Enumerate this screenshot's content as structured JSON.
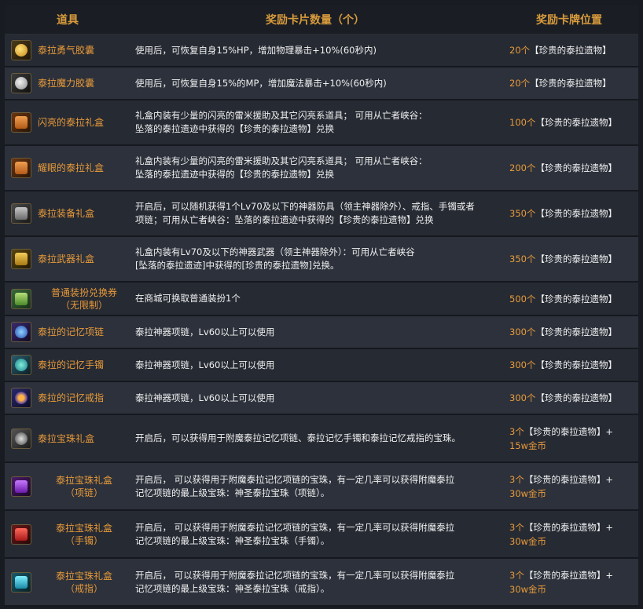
{
  "header": {
    "item": "道具",
    "quantity": "奖励卡片数量（个）",
    "position": "奖励卡牌位置"
  },
  "rows": [
    {
      "icon": "gold-capsule-icon",
      "name_lines": [
        "泰拉勇气胶囊"
      ],
      "desc_lines": [
        "使用后，可恢复自身15%HP，增加物理暴击+10%(60秒内)"
      ],
      "reward_num": "20个",
      "reward_text": "【珍贵的泰拉遗物】",
      "reward_extra": ""
    },
    {
      "icon": "silver-capsule-icon",
      "name_lines": [
        "泰拉魔力胶囊"
      ],
      "desc_lines": [
        "使用后，可恢复自身15%的MP，增加魔法暴击+10%(60秒内)"
      ],
      "reward_num": "20个",
      "reward_text": "【珍贵的泰拉遗物】",
      "reward_extra": ""
    },
    {
      "icon": "orange-giftbox-icon",
      "name_lines": [
        "闪亮的泰拉礼盒"
      ],
      "desc_lines": [
        "礼盒内装有少量的闪亮的雷米援助及其它闪亮系道具； 可用从亡者峡谷：",
        "坠落的泰拉遗迹中获得的【珍贵的泰拉遗物】兑换"
      ],
      "reward_num": "100个",
      "reward_text": "【珍贵的泰拉遗物】",
      "reward_extra": ""
    },
    {
      "icon": "orange-giftbox-icon",
      "name_lines": [
        "耀眼的泰拉礼盒"
      ],
      "desc_lines": [
        "礼盒内装有少量的闪亮的雷米援助及其它闪亮系道具； 可用从亡者峡谷：",
        "坠落的泰拉遗迹中获得的【珍贵的泰拉遗物】兑换"
      ],
      "reward_num": "200个",
      "reward_text": "【珍贵的泰拉遗物】",
      "reward_extra": ""
    },
    {
      "icon": "gray-equipbox-icon",
      "name_lines": [
        "泰拉装备礼盒"
      ],
      "desc_lines": [
        "开启后，可以随机获得1个Lv70及以下的神器防具（领主神器除外）、戒指、手镯或者",
        "项链；可用从亡者峡谷：坠落的泰拉遗迹中获得的【珍贵的泰拉遗物】兑换"
      ],
      "reward_num": "350个",
      "reward_text": "【珍贵的泰拉遗物】",
      "reward_extra": ""
    },
    {
      "icon": "gold-weaponbox-icon",
      "name_lines": [
        "泰拉武器礼盒"
      ],
      "desc_lines": [
        "礼盒内装有Lv70及以下的神器武器（领主神器除外）：可用从亡者峡谷",
        "[坠落的泰拉遗迹]中获得的[珍贵的泰拉遗物]兑换。"
      ],
      "reward_num": "350个",
      "reward_text": "【珍贵的泰拉遗物】",
      "reward_extra": ""
    },
    {
      "icon": "avatar-ticket-icon",
      "name_lines": [
        "普通装扮兑换券",
        "（无限制）"
      ],
      "name_center": true,
      "desc_lines": [
        "在商城可换取普通装扮1个"
      ],
      "reward_num": "500个",
      "reward_text": "【珍贵的泰拉遗物】",
      "reward_extra": ""
    },
    {
      "icon": "necklace-icon",
      "name_lines": [
        "泰拉的记忆项链"
      ],
      "desc_lines": [
        "泰拉神器项链，Lv60以上可以使用"
      ],
      "reward_num": "300个",
      "reward_text": "【珍贵的泰拉遗物】",
      "reward_extra": ""
    },
    {
      "icon": "bracelet-icon",
      "name_lines": [
        "泰拉的记忆手镯"
      ],
      "desc_lines": [
        "泰拉神器项链，Lv60以上可以使用"
      ],
      "reward_num": "300个",
      "reward_text": "【珍贵的泰拉遗物】",
      "reward_extra": ""
    },
    {
      "icon": "ring-icon",
      "name_lines": [
        "泰拉的记忆戒指"
      ],
      "desc_lines": [
        "泰拉神器项链，Lv60以上可以使用"
      ],
      "reward_num": "300个",
      "reward_text": "【珍贵的泰拉遗物】",
      "reward_extra": ""
    },
    {
      "icon": "gem-giftbox-icon",
      "name_lines": [
        "泰拉宝珠礼盒"
      ],
      "desc_lines": [
        "开启后，可以获得用于附魔泰拉记忆项链、泰拉记忆手镯和泰拉记忆戒指的宝珠。"
      ],
      "reward_num": "3个",
      "reward_text": "【珍贵的泰拉遗物】+",
      "reward_extra": "15w金币"
    },
    {
      "icon": "purple-gembox-icon",
      "name_lines": [
        "泰拉宝珠礼盒",
        "（项链）"
      ],
      "name_center": true,
      "desc_lines": [
        "开启后， 可以获得用于附魔泰拉记忆项链的宝珠，有一定几率可以获得附魔泰拉",
        "记忆项链的最上级宝珠：神圣泰拉宝珠（项链）。"
      ],
      "reward_num": "3个",
      "reward_text": "【珍贵的泰拉遗物】+",
      "reward_extra": "30w金币"
    },
    {
      "icon": "red-gembox-icon",
      "name_lines": [
        "泰拉宝珠礼盒",
        "（手镯）"
      ],
      "name_center": true,
      "desc_lines": [
        "开启后， 可以获得用于附魔泰拉记忆项链的宝珠，有一定几率可以获得附魔泰拉",
        "记忆项链的最上级宝珠：神圣泰拉宝珠（手镯）。"
      ],
      "reward_num": "3个",
      "reward_text": "【珍贵的泰拉遗物】+",
      "reward_extra": "30w金币"
    },
    {
      "icon": "teal-gembox-icon",
      "name_lines": [
        "泰拉宝珠礼盒",
        "（戒指）"
      ],
      "name_center": true,
      "desc_lines": [
        "开启后， 可以获得用于附魔泰拉记忆项链的宝珠，有一定几率可以获得附魔泰拉",
        "记忆项链的最上级宝珠：神圣泰拉宝珠（戒指）。"
      ],
      "reward_num": "3个",
      "reward_text": "【珍贵的泰拉遗物】+",
      "reward_extra": "30w金币"
    }
  ]
}
